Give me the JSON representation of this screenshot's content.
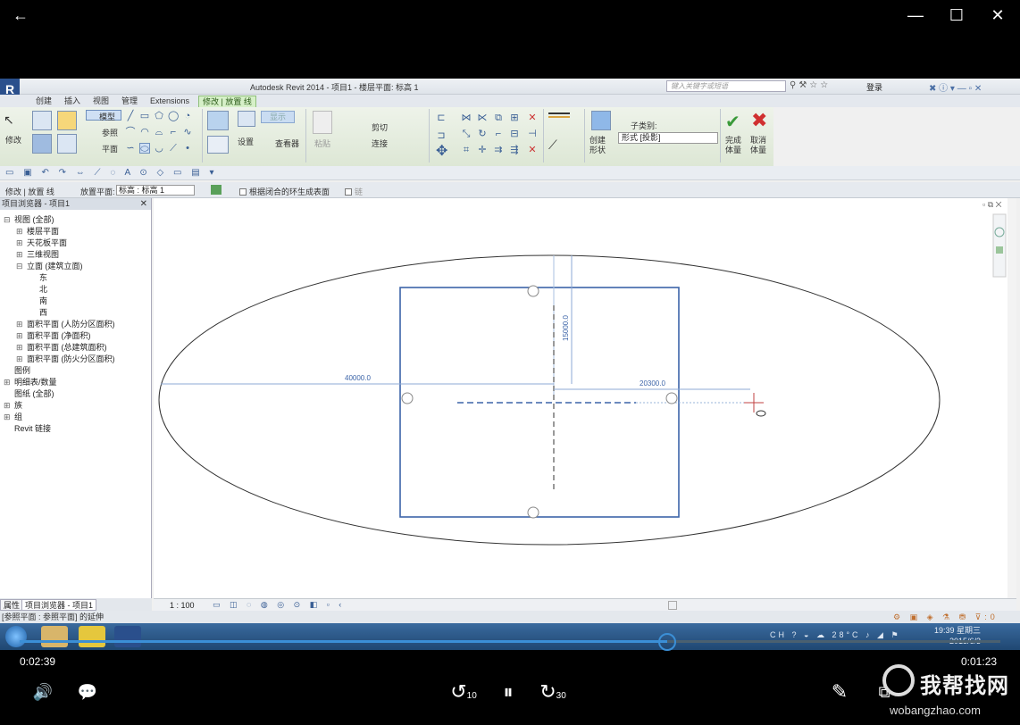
{
  "player": {
    "back_icon": "←",
    "minimize_icon": "—",
    "maximize_icon": "☐",
    "close_icon": "✕",
    "current_time": "0:02:39",
    "remaining_time": "0:01:23",
    "progress": 0.66,
    "rewind_label": "10",
    "forward_label": "30",
    "volume_icon": "🔊",
    "subtitles_icon": "💬",
    "pause_icon": "⏸",
    "edit_icon": "✎",
    "pip_icon": "⧉",
    "accent_color": "#3b8fd6"
  },
  "revit": {
    "app_logo": "R",
    "title": "Autodesk Revit 2014 -    项目1 - 楼层平面: 标高 1",
    "search_placeholder": "键入关键字或短语",
    "login": "登录",
    "tabs": [
      "创建",
      "插入",
      "视图",
      "管理",
      "Extensions",
      "修改 | 放置 线"
    ],
    "active_tab": 5,
    "ribbon": {
      "modify": "修改",
      "model": "模型",
      "reference": "参照",
      "plane": "平面",
      "settings": "设置",
      "show": "显示",
      "viewer": "查看器",
      "paste": "粘贴",
      "cut": "剪切",
      "join": "连接",
      "create_form": "创建\n形状",
      "subcategory": "子类别:",
      "subcategory_value": "形式 [投影]",
      "finish_mass": "完成\n体量",
      "cancel_mass": "取消\n体量"
    },
    "options_bar": {
      "context": "修改 | 放置 线",
      "placement_plane_label": "放置平面:",
      "placement_plane_value": "标高 : 标高 1",
      "closed_loop_label": "根据闭合的环生成表面",
      "chain_label": "链"
    },
    "browser": {
      "title": "项目浏览器 - 项目1",
      "close": "✕",
      "items": [
        {
          "label": "视图 (全部)",
          "indent": 0,
          "toggle": "⊟"
        },
        {
          "label": "楼层平面",
          "indent": 1,
          "toggle": "⊞"
        },
        {
          "label": "天花板平面",
          "indent": 1,
          "toggle": "⊞"
        },
        {
          "label": "三维视图",
          "indent": 1,
          "toggle": "⊞"
        },
        {
          "label": "立面 (建筑立面)",
          "indent": 1,
          "toggle": "⊟"
        },
        {
          "label": "东",
          "indent": 2,
          "toggle": ""
        },
        {
          "label": "北",
          "indent": 2,
          "toggle": ""
        },
        {
          "label": "南",
          "indent": 2,
          "toggle": ""
        },
        {
          "label": "西",
          "indent": 2,
          "toggle": ""
        },
        {
          "label": "面积平面 (人防分区面积)",
          "indent": 1,
          "toggle": "⊞"
        },
        {
          "label": "面积平面 (净面积)",
          "indent": 1,
          "toggle": "⊞"
        },
        {
          "label": "面积平面 (总建筑面积)",
          "indent": 1,
          "toggle": "⊞"
        },
        {
          "label": "面积平面 (防火分区面积)",
          "indent": 1,
          "toggle": "⊞"
        },
        {
          "label": "图例",
          "indent": 0,
          "toggle": ""
        },
        {
          "label": "明细表/数量",
          "indent": 0,
          "toggle": "⊞"
        },
        {
          "label": "图纸 (全部)",
          "indent": 0,
          "toggle": ""
        },
        {
          "label": "族",
          "indent": 0,
          "toggle": "⊞"
        },
        {
          "label": "组",
          "indent": 0,
          "toggle": "⊞"
        },
        {
          "label": "Revit 链接",
          "indent": 0,
          "toggle": ""
        }
      ],
      "tab_properties": "属性",
      "tab_browser": "项目浏览器 - 项目1"
    },
    "canvas": {
      "dim_horizontal": "40000.0",
      "dim_vertical": "15000.0",
      "dim_radius": "20300.0",
      "line_color": "#3c64a8"
    },
    "view_scale": "1 : 100",
    "status_text": "[参照平面 : 参照平面] 的延伸",
    "taskbar": {
      "clock_time": "19:39 星期三",
      "clock_date": "2015/6/3"
    }
  },
  "watermark": {
    "site_name": "我帮找网",
    "url": "wobangzhao.com"
  }
}
